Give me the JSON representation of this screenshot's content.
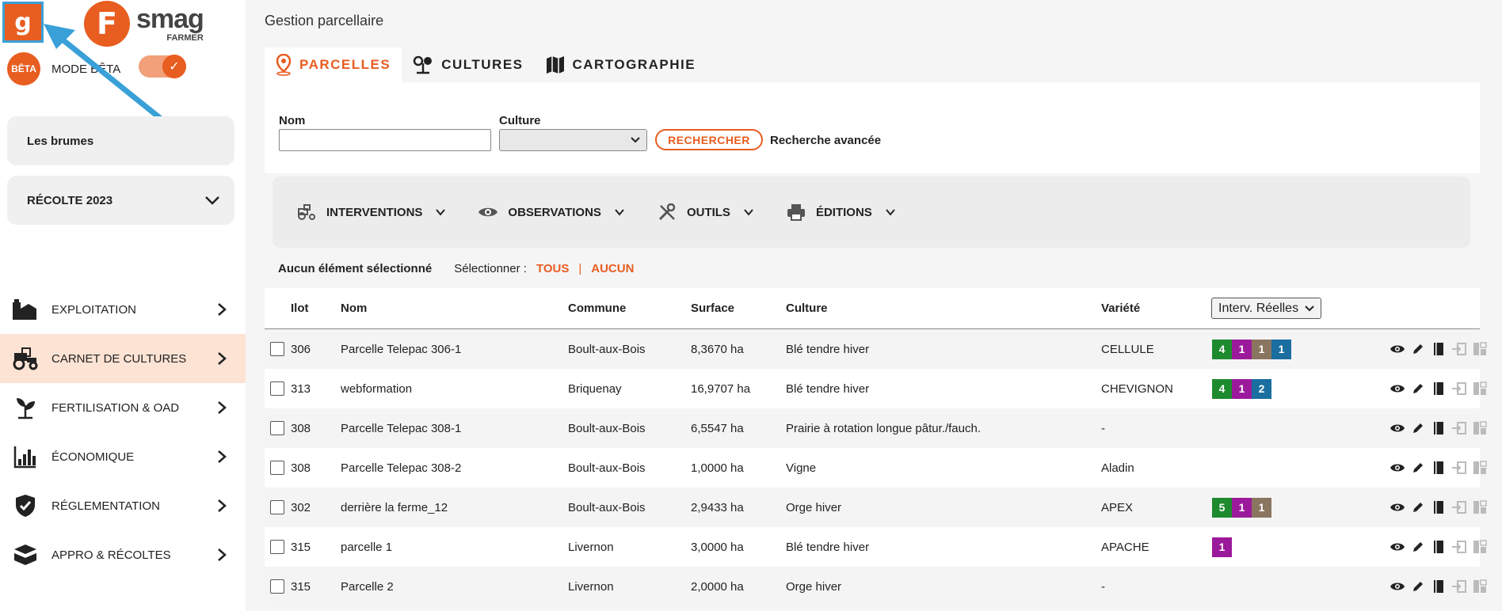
{
  "brand": {
    "switch_glyph": "g",
    "logo_glyph": "F",
    "name": "smag",
    "sub": "FARMER"
  },
  "beta": {
    "badge": "BÊTA",
    "label": "MODE BÊTA",
    "enabled": true
  },
  "farm": "Les brumes",
  "harvest": "RÉCOLTE 2023",
  "nav": [
    {
      "label": "EXPLOITATION",
      "icon": "farm-icon",
      "active": false
    },
    {
      "label": "CARNET DE CULTURES",
      "icon": "tractor-icon",
      "active": true
    },
    {
      "label": "FERTILISATION & OAD",
      "icon": "plant-icon",
      "active": false
    },
    {
      "label": "ÉCONOMIQUE",
      "icon": "chart-icon",
      "active": false
    },
    {
      "label": "RÉGLEMENTATION",
      "icon": "shield-check-icon",
      "active": false
    },
    {
      "label": "APPRO & RÉCOLTES",
      "icon": "boxes-icon",
      "active": false
    }
  ],
  "page_title": "Gestion parcellaire",
  "tabs": [
    {
      "label": "PARCELLES",
      "icon": "map-pin-icon",
      "active": true
    },
    {
      "label": "CULTURES",
      "icon": "sprout-icon",
      "active": false
    },
    {
      "label": "CARTOGRAPHIE",
      "icon": "map-icon",
      "active": false
    }
  ],
  "filters": {
    "name_label": "Nom",
    "name_value": "",
    "culture_label": "Culture",
    "culture_value": "",
    "search_button": "RECHERCHER",
    "advanced_search": "Recherche avancée"
  },
  "actions": [
    {
      "label": "INTERVENTIONS",
      "icon": "tractor-icon"
    },
    {
      "label": "OBSERVATIONS",
      "icon": "eye-icon"
    },
    {
      "label": "OUTILS",
      "icon": "tools-icon"
    },
    {
      "label": "ÉDITIONS",
      "icon": "printer-icon"
    }
  ],
  "selection": {
    "status": "Aucun élément sélectionné",
    "prefix": "Sélectionner :",
    "all": "TOUS",
    "separator": "|",
    "none": "AUCUN"
  },
  "table": {
    "columns": {
      "ilot": "Ilot",
      "nom": "Nom",
      "commune": "Commune",
      "surface": "Surface",
      "culture": "Culture",
      "variete": "Variété",
      "interv": "Interv. Réelles"
    },
    "badge_colors": {
      "green": "#1e8a2e",
      "purple": "#9b1a9b",
      "brown": "#8a7560",
      "blue": "#1a6ea0"
    },
    "rows": [
      {
        "ilot": "306",
        "nom": "Parcelle Telepac 306-1",
        "commune": "Boult-aux-Bois",
        "surface": "8,3670 ha",
        "culture": "Blé tendre hiver",
        "variete": "CELLULE",
        "badges": [
          {
            "n": "4",
            "c": "green"
          },
          {
            "n": "1",
            "c": "purple"
          },
          {
            "n": "1",
            "c": "brown"
          },
          {
            "n": "1",
            "c": "blue"
          }
        ]
      },
      {
        "ilot": "313",
        "nom": "webformation",
        "commune": "Briquenay",
        "surface": "16,9707 ha",
        "culture": "Blé tendre hiver",
        "variete": "CHEVIGNON",
        "badges": [
          {
            "n": "4",
            "c": "green"
          },
          {
            "n": "1",
            "c": "purple"
          },
          {
            "n": "2",
            "c": "blue"
          }
        ]
      },
      {
        "ilot": "308",
        "nom": "Parcelle Telepac 308-1",
        "commune": "Boult-aux-Bois",
        "surface": "6,5547 ha",
        "culture": "Prairie à rotation longue pâtur./fauch.",
        "variete": "-",
        "badges": []
      },
      {
        "ilot": "308",
        "nom": "Parcelle Telepac 308-2",
        "commune": "Boult-aux-Bois",
        "surface": "1,0000 ha",
        "culture": "Vigne",
        "variete": "Aladin",
        "badges": []
      },
      {
        "ilot": "302",
        "nom": "derrière la ferme_12",
        "commune": "Boult-aux-Bois",
        "surface": "2,9433 ha",
        "culture": "Orge hiver",
        "variete": "APEX",
        "badges": [
          {
            "n": "5",
            "c": "green"
          },
          {
            "n": "1",
            "c": "purple"
          },
          {
            "n": "1",
            "c": "brown"
          }
        ]
      },
      {
        "ilot": "315",
        "nom": "parcelle 1",
        "commune": "Livernon",
        "surface": "3,0000 ha",
        "culture": "Blé tendre hiver",
        "variete": "APACHE",
        "badges": [
          {
            "n": "1",
            "c": "purple"
          }
        ]
      },
      {
        "ilot": "315",
        "nom": "Parcelle 2",
        "commune": "Livernon",
        "surface": "2,0000 ha",
        "culture": "Orge hiver",
        "variete": "-",
        "badges": []
      }
    ]
  },
  "colors": {
    "accent": "#e85d20",
    "highlight": "#3aa0d8",
    "active_nav_bg": "#fde3d4"
  }
}
